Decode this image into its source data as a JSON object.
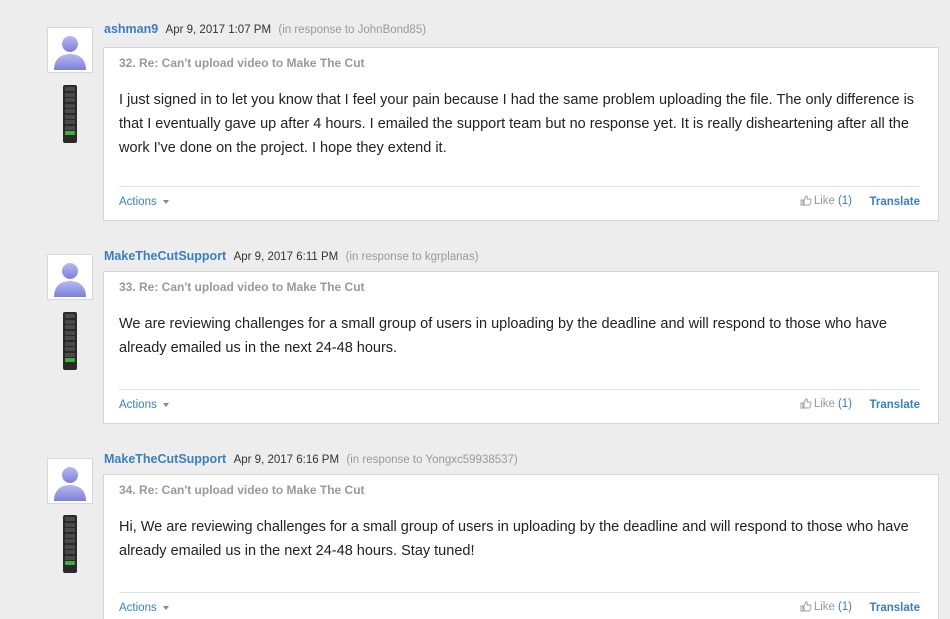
{
  "posts": [
    {
      "author": "ashman9",
      "date": "Apr 9, 2017 1:07 PM",
      "reply_to": "(in response to JohnBond85)",
      "title": "32. Re: Can't upload video to Make The Cut",
      "body": "I just signed in to let you know that I feel your pain because I had the same problem uploading the file. The only difference is that I eventually gave up after 4 hours. I emailed the support team but no response yet. It is really disheartening after all the work I've done on the project. I hope they extend it.",
      "actions_label": "Actions",
      "like_label": "Like",
      "like_count": "(1)",
      "translate_label": "Translate",
      "status_level": 1
    },
    {
      "author": "MakeTheCutSupport",
      "date": "Apr 9, 2017 6:11 PM",
      "reply_to": "(in response to kgrplanas)",
      "title": "33. Re: Can't upload video to Make The Cut",
      "body": "We are reviewing challenges for a small group of users in uploading by the deadline and will respond to those who have already emailed us in the next 24-48 hours.",
      "actions_label": "Actions",
      "like_label": "Like",
      "like_count": "(1)",
      "translate_label": "Translate",
      "status_level": 1
    },
    {
      "author": "MakeTheCutSupport",
      "date": "Apr 9, 2017 6:16 PM",
      "reply_to": "(in response to Yongxc59938537)",
      "title": "34. Re: Can't upload video to Make The Cut",
      "body": "Hi, We are reviewing challenges for a small group of users in uploading by the deadline and will respond to those who have already emailed us in the next 24-48 hours. Stay tuned!",
      "actions_label": "Actions",
      "like_label": "Like",
      "like_count": "(1)",
      "translate_label": "Translate",
      "status_level": 1
    }
  ],
  "colors": {
    "link": "#3a7fc1",
    "status_on": "#3fae3f",
    "muted": "#999999"
  },
  "icons": {
    "avatar": "default-user-avatar-icon",
    "like": "thumbs-up-icon",
    "actions": "caret-down-icon"
  }
}
